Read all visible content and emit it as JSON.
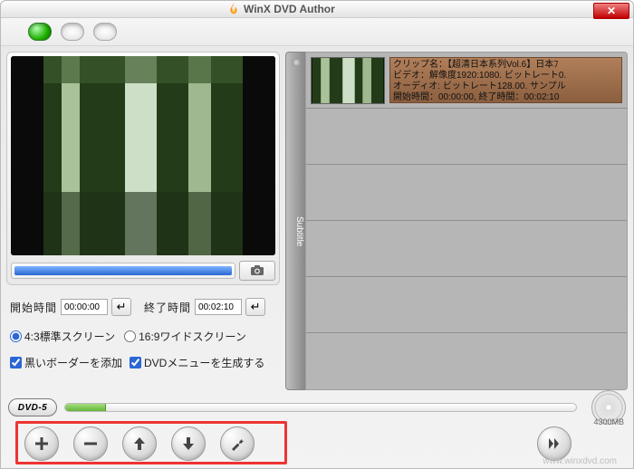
{
  "window": {
    "title": "WinX DVD Author"
  },
  "preview": {
    "progress_percent": 100
  },
  "times": {
    "start_label": "開始時間",
    "start_value": "00:00:00",
    "end_label": "終了時間",
    "end_value": "00:02:10"
  },
  "aspect": {
    "opt_43": "4:3標準スクリーン",
    "opt_169": "16:9ワイドスクリーン",
    "selected": "4:3"
  },
  "options": {
    "border_label": "黒いボーダーを添加",
    "menu_label": "DVDメニューを生成する",
    "border_checked": true,
    "menu_checked": true
  },
  "subtitle_tab": "Subtitle",
  "clip": {
    "line1": "クリップ名：【超清日本系列Vol.6】日本ﾌ",
    "line2": "ビデオ：解像度1920:1080. ビットレート0.",
    "line3": "オーディオ: ビットレート128.00. サンプル",
    "line4": "開始時間：00:00:00, 終了時間：00:02:10"
  },
  "capacity": {
    "dvd_type": "DVD-5",
    "total_label": "4300MB",
    "used_percent": 8
  },
  "watermark": "www.winxdvd.com"
}
